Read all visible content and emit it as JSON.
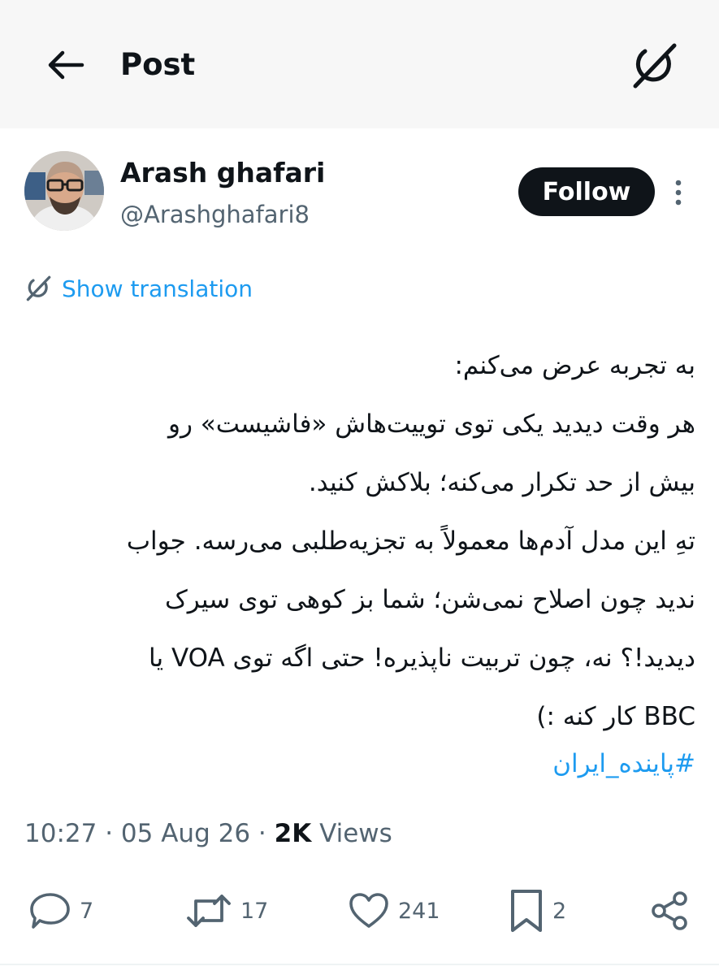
{
  "header": {
    "title": "Post",
    "back_icon": "arrow-left-icon",
    "grok_icon": "grok-icon"
  },
  "author": {
    "name": "Arash ghafari",
    "handle": "@Arashghafari8",
    "follow_label": "Follow"
  },
  "translation": {
    "label": "Show translation"
  },
  "tweet": {
    "lines": [
      "به تجربه عرض می‌کنم:",
      "هر وقت دیدید یکی توی توییت‌هاش «فاشیست» رو",
      "بیش از حد تکرار می‌کنه؛ بلاکش کنید.",
      "تهِ این مدل آدم‌ها معمولاً به تجزیه‌طلبی می‌رسه. جواب",
      "ندید چون اصلاح نمی‌شن؛ شما بز کوهی توی سیرک",
      "دیدید!؟ نه، چون تربیت ناپذیره! حتی اگه توی VOA یا",
      "BBC کار کنه :)"
    ],
    "hashtag": "#پاینده_ایران"
  },
  "meta": {
    "time": "10:27",
    "date": "05 Aug 26",
    "views_count": "2K",
    "views_label": "Views"
  },
  "actions": {
    "replies": "7",
    "reposts": "17",
    "likes": "241",
    "bookmarks": "2"
  },
  "colors": {
    "accent": "#1d9bf0",
    "text": "#0f1419",
    "secondary": "#536471",
    "header_bg": "#f7f7f7"
  }
}
